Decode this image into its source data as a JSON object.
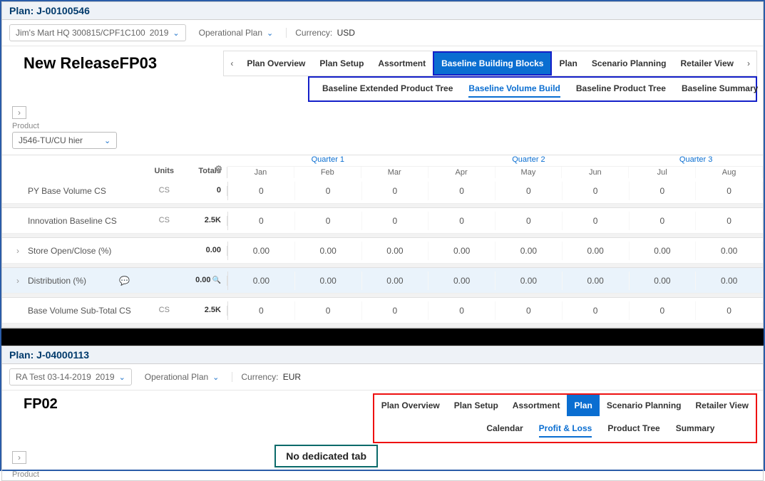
{
  "top": {
    "plan_title": "Plan: J-00100546",
    "filter": {
      "customer": "Jim's Mart HQ 300815/CPF1C100",
      "year": "2019",
      "plan_type": "Operational Plan",
      "currency_label": "Currency:",
      "currency_value": "USD"
    },
    "release_label": "New ReleaseFP03",
    "tabs": [
      "Plan Overview",
      "Plan Setup",
      "Assortment",
      "Baseline Building Blocks",
      "Plan",
      "Scenario Planning",
      "Retailer View"
    ],
    "active_tab": "Baseline Building Blocks",
    "subtabs": [
      "Baseline Extended Product Tree",
      "Baseline Volume Build",
      "Baseline Product Tree",
      "Baseline Summary"
    ],
    "active_subtab": "Baseline Volume Build",
    "product_label": "Product",
    "product_value": "J546-TU/CU hier",
    "col_units": "Units",
    "col_totals": "Totals",
    "quarters": [
      "Quarter 1",
      "Quarter 2",
      "Quarter 3"
    ],
    "months": [
      [
        "Jan",
        "Feb",
        "Mar"
      ],
      [
        "Apr",
        "May",
        "Jun"
      ],
      [
        "Jul",
        "Aug"
      ]
    ],
    "rows": [
      {
        "metric": "PY Base Volume  CS",
        "units": "CS",
        "total": "0",
        "vals": [
          "0",
          "0",
          "0",
          "0",
          "0",
          "0",
          "0",
          "0"
        ],
        "exp": false
      },
      {
        "metric": "Innovation Baseline    CS",
        "units": "CS",
        "total": "2.5K",
        "vals": [
          "0",
          "0",
          "0",
          "0",
          "0",
          "0",
          "0",
          "0"
        ],
        "exp": false
      },
      {
        "metric": "Store Open/Close (%)",
        "units": "",
        "total": "0.00",
        "vals": [
          "0.00",
          "0.00",
          "0.00",
          "0.00",
          "0.00",
          "0.00",
          "0.00",
          "0.00"
        ],
        "exp": true
      },
      {
        "metric": "Distribution (%)",
        "units": "",
        "total": "0.00",
        "vals": [
          "0.00",
          "0.00",
          "0.00",
          "0.00",
          "0.00",
          "0.00",
          "0.00",
          "0.00"
        ],
        "exp": true,
        "sel": true,
        "comment": true,
        "zoom": true
      },
      {
        "metric": "Base Volume Sub-Total  CS",
        "units": "CS",
        "total": "2.5K",
        "vals": [
          "0",
          "0",
          "0",
          "0",
          "0",
          "0",
          "0",
          "0"
        ],
        "exp": false
      }
    ]
  },
  "bottom": {
    "plan_title": "Plan: J-04000113",
    "filter": {
      "customer": "RA Test 03-14-2019",
      "year": "2019",
      "plan_type": "Operational Plan",
      "currency_label": "Currency:",
      "currency_value": "EUR"
    },
    "release_label": "FP02",
    "tabs": [
      "Plan Overview",
      "Plan Setup",
      "Assortment",
      "Plan",
      "Scenario Planning",
      "Retailer View"
    ],
    "active_tab": "Plan",
    "subtabs": [
      "Calendar",
      "Profit & Loss",
      "Product Tree",
      "Summary"
    ],
    "active_subtab": "Profit & Loss",
    "no_dedicated_label": "No dedicated tab",
    "product_label": "Product"
  }
}
